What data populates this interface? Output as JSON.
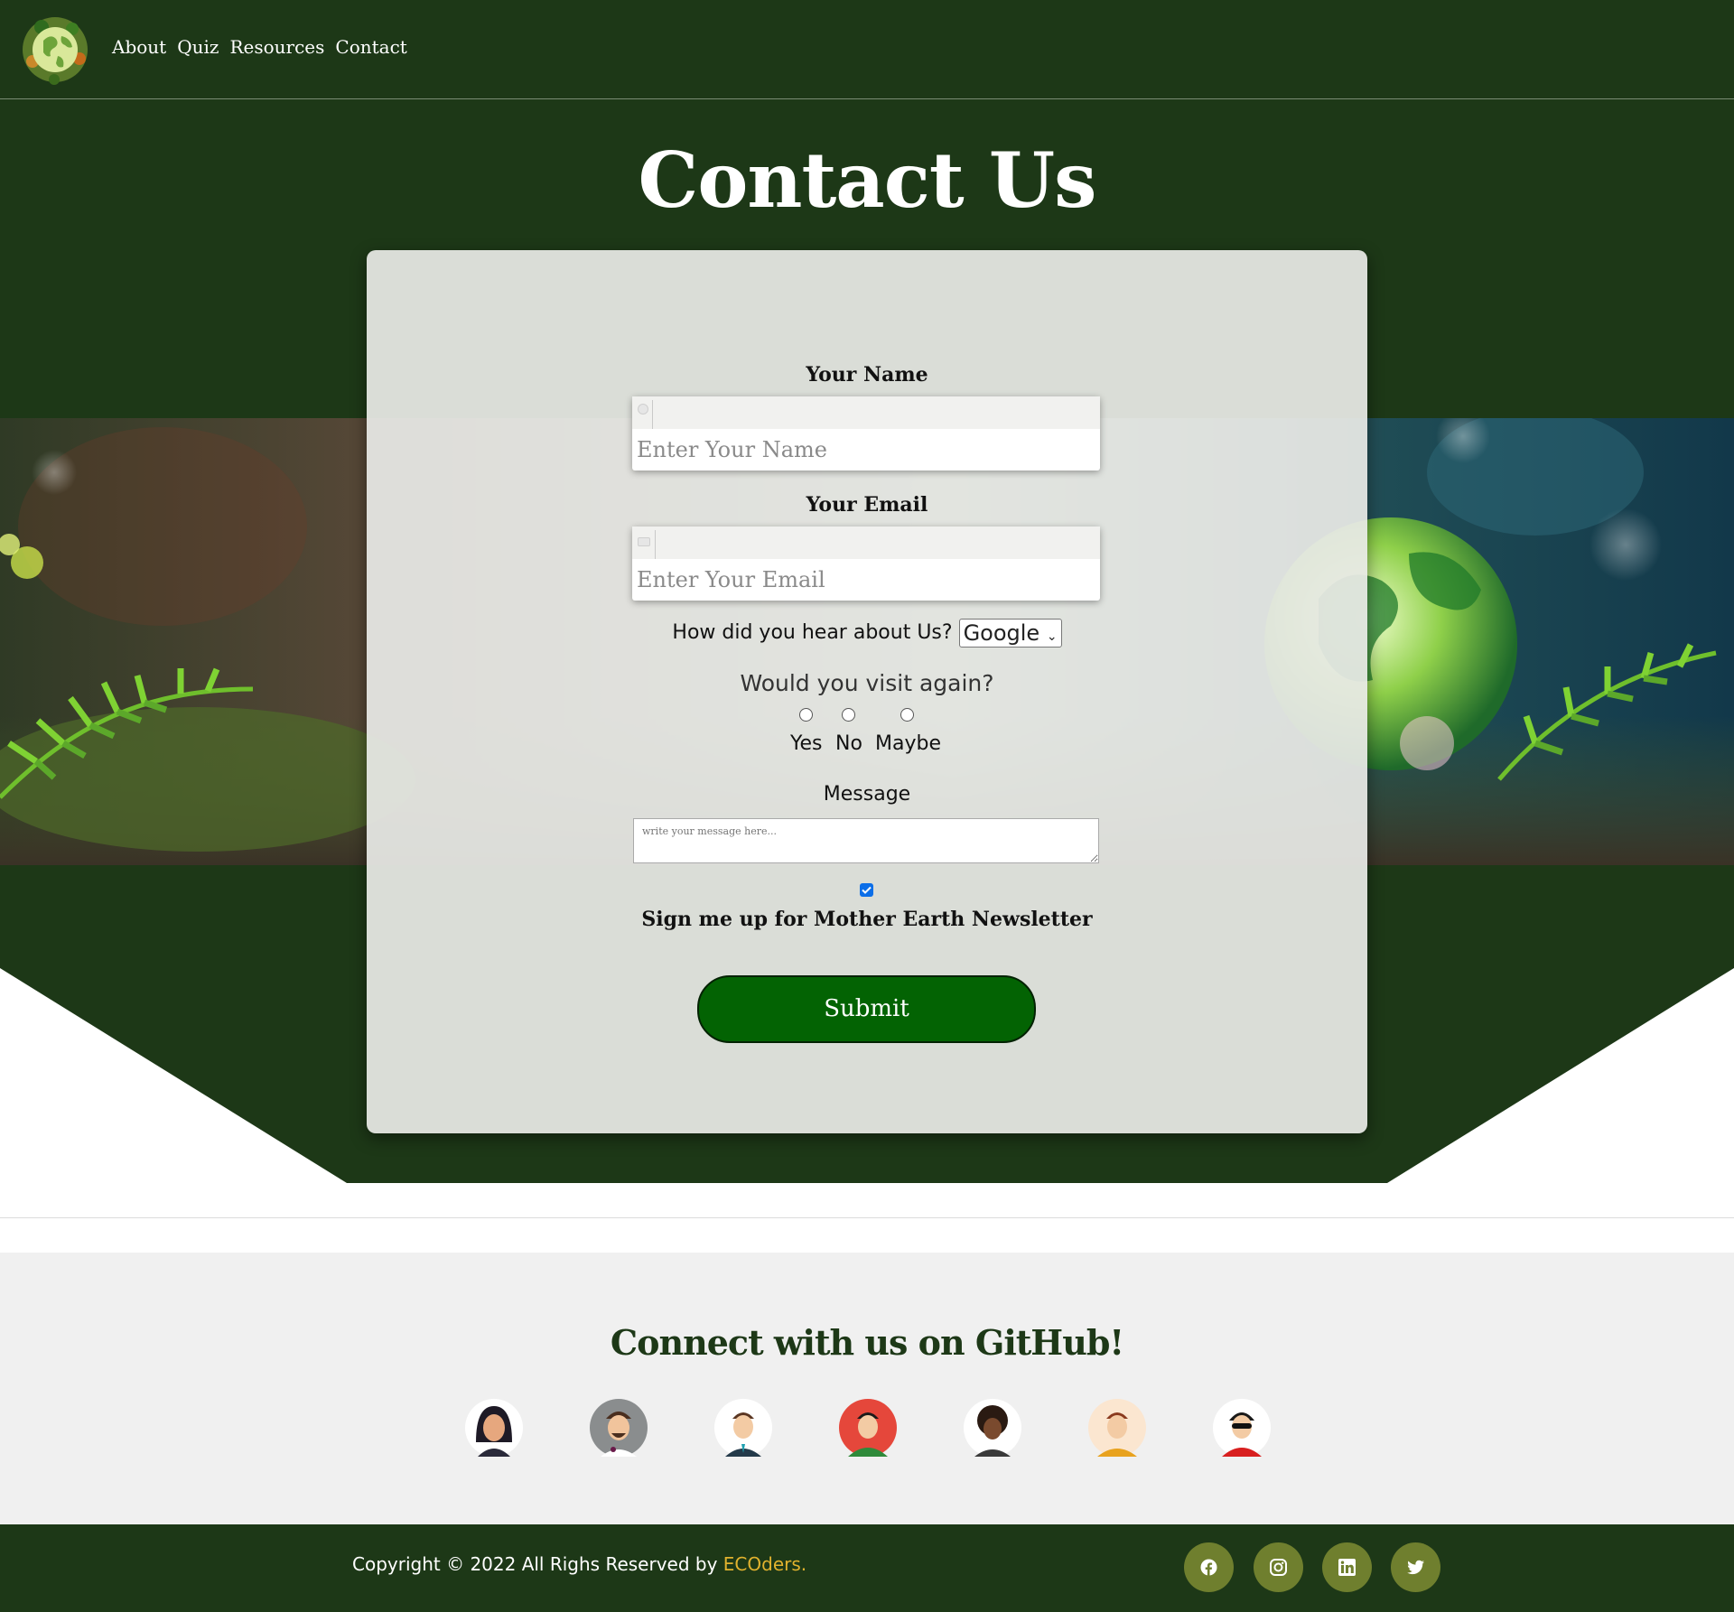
{
  "nav": {
    "links": [
      "About",
      "Quiz",
      "Resources",
      "Contact"
    ]
  },
  "hero": {
    "title": "Contact Us"
  },
  "form": {
    "name_label": "Your Name",
    "name_placeholder": "Enter Your Name",
    "email_label": "Your Email",
    "email_placeholder": "Enter Your Email",
    "source_question": "How did you hear about Us?",
    "source_selected": "Google",
    "visit_question": "Would you visit again?",
    "visit_options": [
      "Yes",
      "No",
      "Maybe"
    ],
    "message_label": "Message",
    "message_placeholder": "write your message here...",
    "newsletter_label": "Sign me up for Mother Earth Newsletter",
    "newsletter_checked": true,
    "submit_label": "Submit"
  },
  "github": {
    "title": "Connect with us on GitHub!",
    "avatar_count": 7
  },
  "footer": {
    "copyright_prefix": "Copyright © 2022 All Righs Reserved by ",
    "brand": "ECOders.",
    "social_icons": [
      "facebook-icon",
      "instagram-icon",
      "linkedin-icon",
      "twitter-icon"
    ]
  },
  "colors": {
    "dark_green": "#1d3817",
    "submit_green": "#036303",
    "brand_gold": "#e1b22e",
    "social_olive": "#6f7f2e"
  }
}
